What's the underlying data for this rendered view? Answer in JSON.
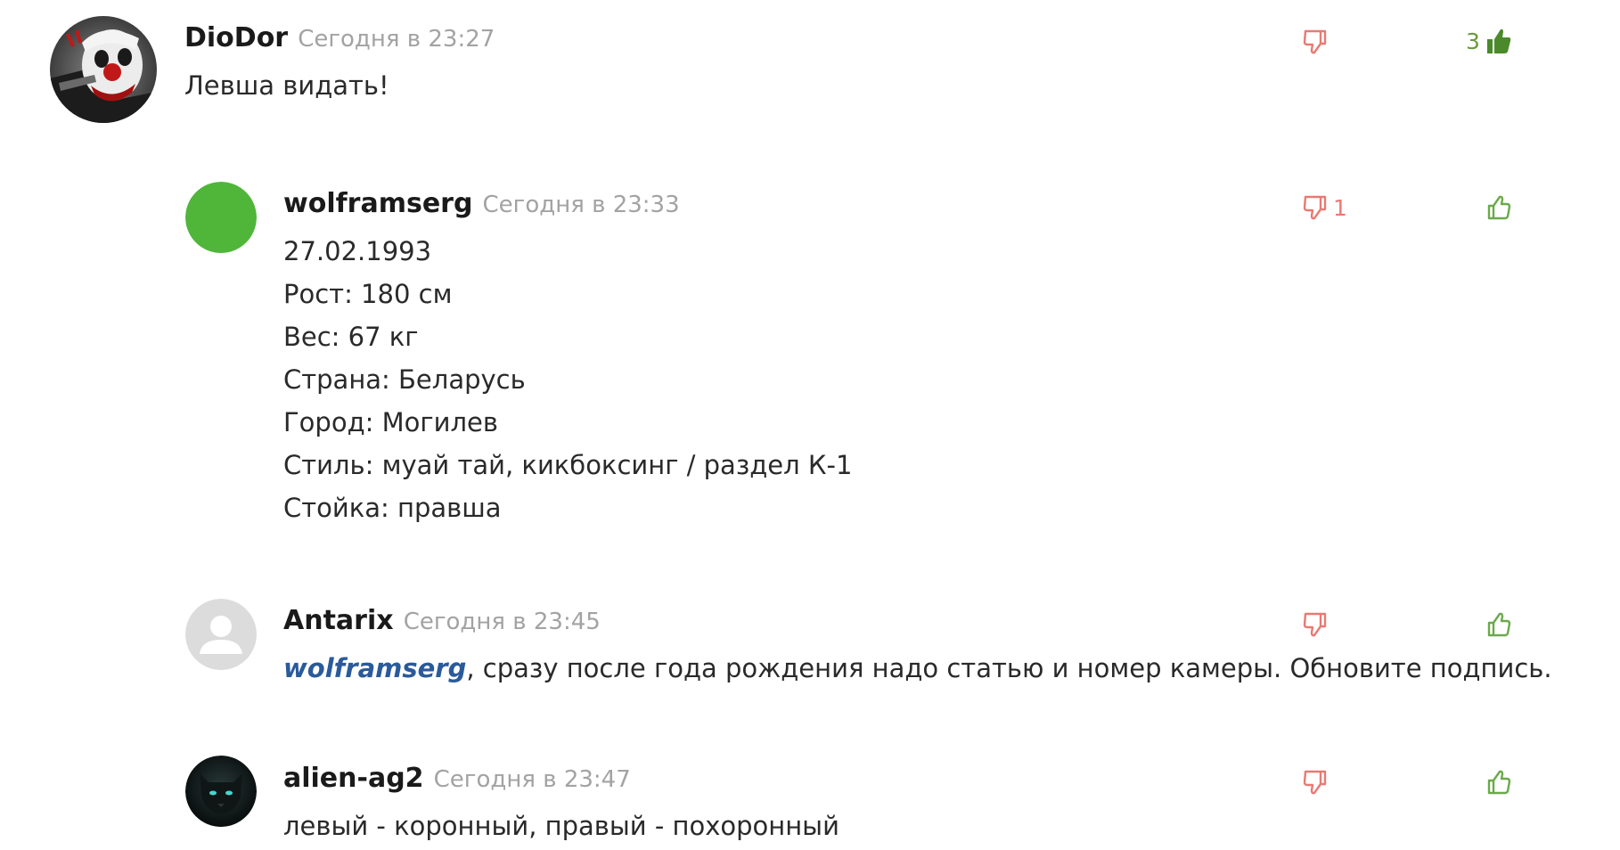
{
  "comments": [
    {
      "author": "DioDor",
      "time": "Сегодня в 23:27",
      "avatar": "clown-avatar",
      "lines": [
        "Левша видать!"
      ],
      "dislikes": "",
      "likes": "3",
      "liked": true
    },
    {
      "author": "wolframserg",
      "time": "Сегодня в 23:33",
      "avatar": "green-circle-avatar",
      "lines": [
        "27.02.1993",
        "Рост: 180 см",
        "Вес: 67 кг",
        "Страна: Беларусь",
        "Город: Могилев",
        "Стиль: муай тай, кикбоксинг / раздел К-1",
        "Стойка: правша"
      ],
      "dislikes": "1",
      "likes": "",
      "liked": false
    },
    {
      "author": "Antarix",
      "time": "Сегодня в 23:45",
      "avatar": "default-user-avatar",
      "mention": "wolframserg",
      "text_after_mention": ", сразу после года рождения надо статью и номер камеры. Обновите подпись.",
      "dislikes": "",
      "likes": "",
      "liked": false
    },
    {
      "author": "alien-ag2",
      "time": "Сегодня в 23:47",
      "avatar": "black-panther-avatar",
      "lines": [
        "левый - коронный, правый - похоронный"
      ],
      "dislikes": "",
      "likes": "",
      "liked": false
    }
  ],
  "colors": {
    "dislike": "#e87a73",
    "like_outline": "#6aaa4a",
    "like_filled": "#4a8a2a",
    "like_count": "#6a9a3a",
    "mention": "#2a5a9a",
    "timestamp": "#a3a3a3",
    "green_avatar": "#4fb63a"
  }
}
